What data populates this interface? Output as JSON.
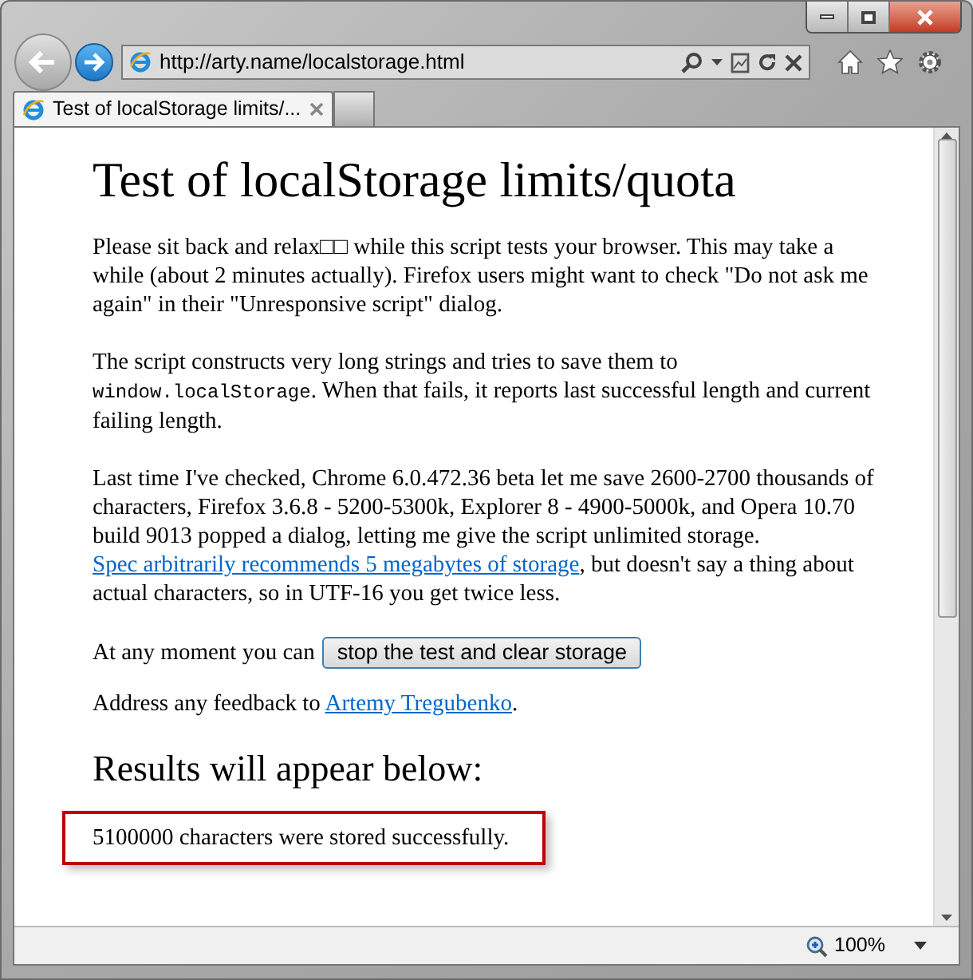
{
  "browser": {
    "address": "http://arty.name/localstorage.html",
    "tabs": [
      {
        "label": "Test of localStorage limits/...",
        "selected": true
      }
    ],
    "zoom": "100%"
  },
  "page": {
    "heading": "Test of localStorage limits/quota",
    "paragraphs": [
      [
        {
          "kind": "text",
          "text": "Please sit back and relax□□ while this script tests your browser. This may take a while (about 2 minutes actually). Firefox users might want to check \"Do not ask me again\" in their \"Unresponsive script\" dialog."
        }
      ],
      [
        {
          "kind": "text",
          "text": "The script constructs very long strings and tries to save them to "
        },
        {
          "kind": "code",
          "text": "window.localStorage"
        },
        {
          "kind": "text",
          "text": ". When that fails, it reports last successful length and current failing length."
        }
      ],
      [
        {
          "kind": "text",
          "text": "Last time I've checked, Chrome 6.0.472.36 beta let me save 2600-2700 thousands of characters, Firefox 3.6.8 - 5200-5300k, Explorer 8 - 4900-5000k, and Opera 10.70 build 9013 popped a dialog, letting me give the script unlimited storage. "
        },
        {
          "kind": "link",
          "text": "Spec arbitrarily recommends 5 megabytes of storage"
        },
        {
          "kind": "text",
          "text": ", but doesn't say a thing about actual characters, so in UTF-16 you get twice less."
        }
      ]
    ],
    "action": {
      "text": "At any moment you can",
      "button": "stop the test and clear storage"
    },
    "feedback": [
      {
        "kind": "text",
        "text": "Address any feedback to "
      },
      {
        "kind": "link",
        "text": "Artemy Tregubenko"
      },
      {
        "kind": "text",
        "text": "."
      }
    ],
    "results_heading": "Results will appear below:",
    "result": "5100000 characters were stored successfully."
  }
}
